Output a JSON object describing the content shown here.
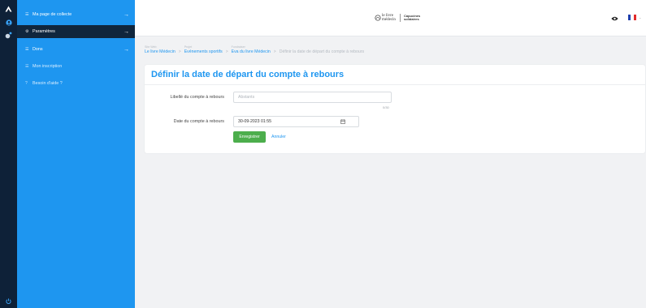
{
  "sidebar": {
    "items": [
      {
        "label": "Ma page de collecte",
        "icon": "list-icon",
        "arrow": "→"
      },
      {
        "label": "Paramètres",
        "icon": "gear-icon",
        "arrow": "→"
      },
      {
        "label": "Dons",
        "icon": "list-icon",
        "arrow": "→"
      },
      {
        "label": "Mon inscription",
        "icon": "list-icon"
      },
      {
        "label": "Besoin d'aide ?",
        "icon": "help-icon"
      }
    ]
  },
  "rail": {
    "icons": [
      "logo-icon",
      "user-icon",
      "settings-icon",
      "power-icon"
    ]
  },
  "header": {
    "logo_part1": "le livre médecin",
    "logo_part2": "Capucines solidaires",
    "eye_icon": "eye-icon",
    "language": "FR"
  },
  "breadcrumb": [
    {
      "caption": "Site Web",
      "value": "Le livre Médecin"
    },
    {
      "caption": "Projet",
      "value": "Evénements sportifs"
    },
    {
      "caption": "Fundraiser",
      "value": "Eva du livre Médecin"
    },
    {
      "caption": "",
      "value": "Définir la date de départ du compte à rebours"
    }
  ],
  "form": {
    "title": "Définir la date de départ du compte à rebours",
    "label_name": "Libellé du compte à rebours",
    "name_placeholder": "Abstants",
    "name_counter": "0/30",
    "label_date": "Date du compte à rebours",
    "date_value": "30-09-2023 01:55",
    "save_label": "Enregistrer",
    "cancel_label": "Annuler"
  },
  "colors": {
    "accent": "#1e96f0",
    "nav_active": "#10263d",
    "rail": "#0e2138",
    "success": "#4cae4c"
  }
}
